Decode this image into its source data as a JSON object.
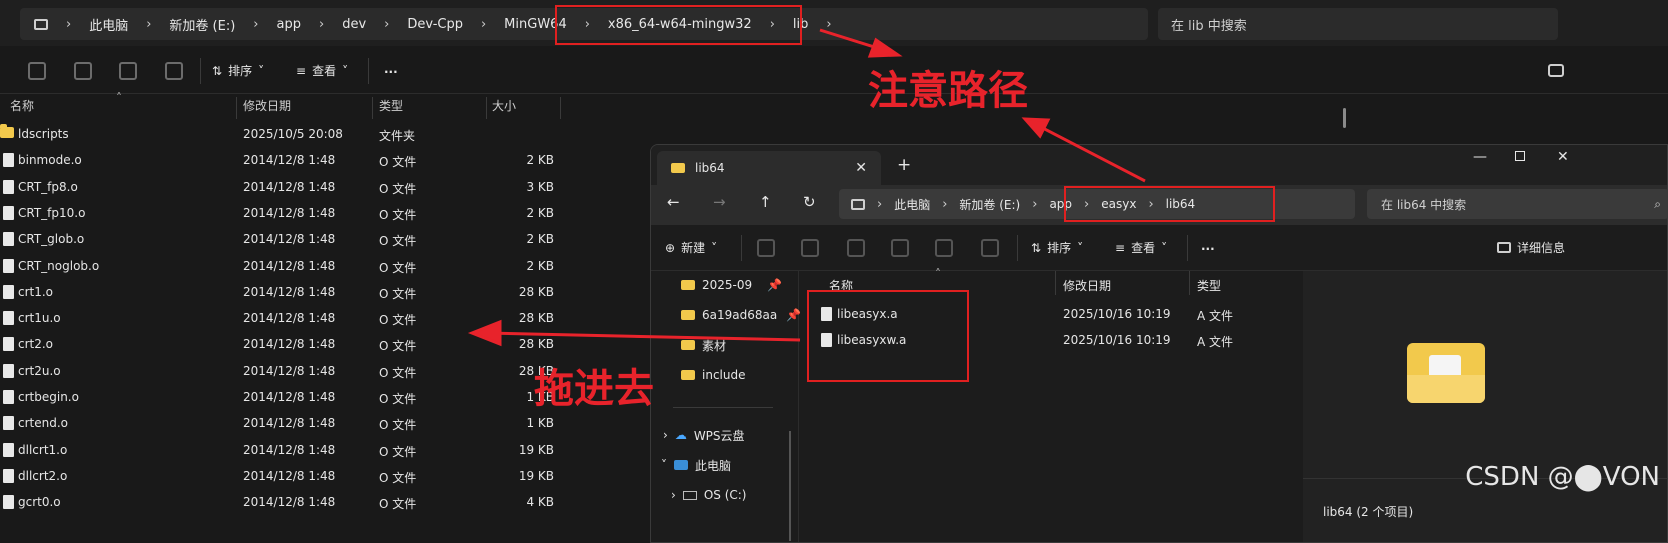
{
  "explorer": {
    "breadcrumb": [
      "此电脑",
      "新加卷 (E:)",
      "app",
      "dev",
      "Dev-Cpp",
      "MinGW64",
      "x86_64-w64-mingw32",
      "lib"
    ],
    "search_placeholder": "在 lib 中搜索",
    "toolbar": {
      "sort": "排序",
      "view": "查看",
      "more": "..."
    },
    "columns": {
      "name": "名称",
      "date": "修改日期",
      "type": "类型",
      "size": "大小"
    },
    "files": [
      {
        "name": "ldscripts",
        "date": "2025/10/5 20:08",
        "type": "文件夹",
        "size": "",
        "kind": "folder"
      },
      {
        "name": "binmode.o",
        "date": "2014/12/8 1:48",
        "type": "O 文件",
        "size": "2 KB",
        "kind": "file"
      },
      {
        "name": "CRT_fp8.o",
        "date": "2014/12/8 1:48",
        "type": "O 文件",
        "size": "3 KB",
        "kind": "file"
      },
      {
        "name": "CRT_fp10.o",
        "date": "2014/12/8 1:48",
        "type": "O 文件",
        "size": "2 KB",
        "kind": "file"
      },
      {
        "name": "CRT_glob.o",
        "date": "2014/12/8 1:48",
        "type": "O 文件",
        "size": "2 KB",
        "kind": "file"
      },
      {
        "name": "CRT_noglob.o",
        "date": "2014/12/8 1:48",
        "type": "O 文件",
        "size": "2 KB",
        "kind": "file"
      },
      {
        "name": "crt1.o",
        "date": "2014/12/8 1:48",
        "type": "O 文件",
        "size": "28 KB",
        "kind": "file"
      },
      {
        "name": "crt1u.o",
        "date": "2014/12/8 1:48",
        "type": "O 文件",
        "size": "28 KB",
        "kind": "file"
      },
      {
        "name": "crt2.o",
        "date": "2014/12/8 1:48",
        "type": "O 文件",
        "size": "28 KB",
        "kind": "file"
      },
      {
        "name": "crt2u.o",
        "date": "2014/12/8 1:48",
        "type": "O 文件",
        "size": "28 KB",
        "kind": "file"
      },
      {
        "name": "crtbegin.o",
        "date": "2014/12/8 1:48",
        "type": "O 文件",
        "size": "1 KB",
        "kind": "file"
      },
      {
        "name": "crtend.o",
        "date": "2014/12/8 1:48",
        "type": "O 文件",
        "size": "1 KB",
        "kind": "file"
      },
      {
        "name": "dllcrt1.o",
        "date": "2014/12/8 1:48",
        "type": "O 文件",
        "size": "19 KB",
        "kind": "file"
      },
      {
        "name": "dllcrt2.o",
        "date": "2014/12/8 1:48",
        "type": "O 文件",
        "size": "19 KB",
        "kind": "file"
      },
      {
        "name": "gcrt0.o",
        "date": "2014/12/8 1:48",
        "type": "O 文件",
        "size": "4 KB",
        "kind": "file"
      }
    ]
  },
  "window2": {
    "tab_title": "lib64",
    "new_tab": "+",
    "breadcrumb": [
      "此电脑",
      "新加卷 (E:)",
      "app",
      "easyx",
      "lib64"
    ],
    "search_placeholder": "在 lib64 中搜索",
    "toolbar": {
      "new": "新建",
      "sort": "排序",
      "view": "查看",
      "more": "...",
      "details": "详细信息"
    },
    "nav": [
      {
        "label": "2025-09",
        "pinned": true
      },
      {
        "label": "6a19ad68aa",
        "pinned": true
      },
      {
        "label": "素材",
        "pinned": false
      },
      {
        "label": "include",
        "pinned": false
      },
      {
        "label": "WPS云盘",
        "pinned": false
      },
      {
        "label": "此电脑",
        "pinned": false
      },
      {
        "label": "OS (C:)",
        "pinned": false
      }
    ],
    "columns": {
      "name": "名称",
      "date": "修改日期",
      "type": "类型"
    },
    "files": [
      {
        "name": "libeasyx.a",
        "date": "2025/10/16 10:19",
        "type": "A 文件"
      },
      {
        "name": "libeasyxw.a",
        "date": "2025/10/16 10:19",
        "type": "A 文件"
      }
    ],
    "status_partial": "lib64 (2 个项目)"
  },
  "annotations": {
    "path_note": "注意路径",
    "drag_note": "拖进去",
    "color": "#e8232b"
  },
  "watermark": "CSDN @⬤VON"
}
